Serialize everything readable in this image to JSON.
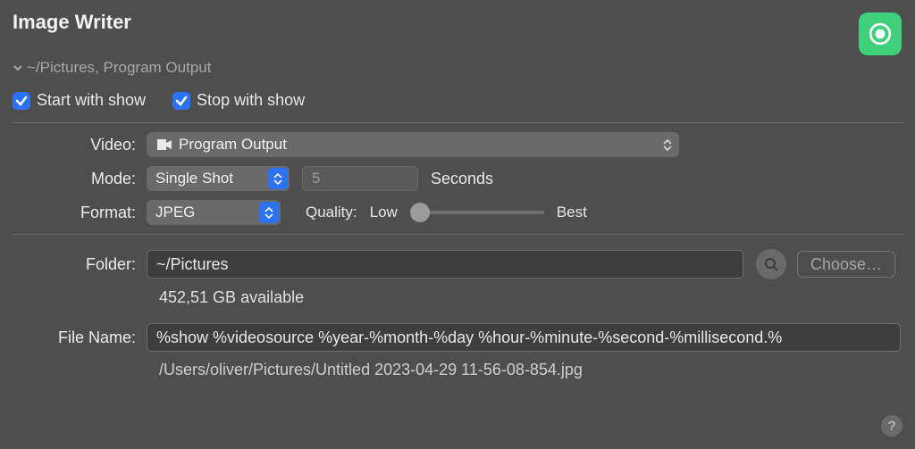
{
  "header": {
    "title": "Image Writer",
    "subtitle": "~/Pictures, Program Output"
  },
  "options": {
    "start_label": "Start with show",
    "stop_label": "Stop with show"
  },
  "video": {
    "label": "Video:",
    "value": "Program Output"
  },
  "mode": {
    "label": "Mode:",
    "value": "Single Shot",
    "interval": "5",
    "unit": "Seconds"
  },
  "format": {
    "label": "Format:",
    "value": "JPEG",
    "quality_label": "Quality:",
    "low": "Low",
    "best": "Best"
  },
  "folder": {
    "label": "Folder:",
    "value": "~/Pictures",
    "choose": "Choose…",
    "available": "452,51 GB available"
  },
  "filename": {
    "label": "File Name:",
    "value": "%show %videosource %year-%month-%day %hour-%minute-%second-%millisecond.%",
    "preview": "/Users/oliver/Pictures/Untitled 2023-04-29 11-56-08-854.jpg"
  },
  "help": "?"
}
